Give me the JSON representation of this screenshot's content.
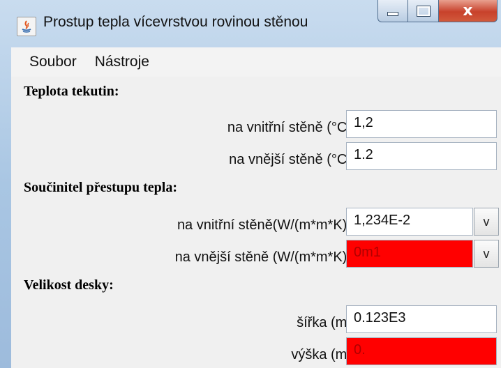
{
  "window": {
    "title": "Prostup tepla vícevrstvou rovinou stěnou",
    "close_glyph": "x"
  },
  "menu": {
    "items": [
      "Soubor",
      "Nástroje"
    ]
  },
  "sections": {
    "fluid_temp": {
      "title": "Teplota tekutin:",
      "inner_label": "na vnitřní stěně (°C)",
      "inner_value": "1,2",
      "outer_label": "na vnější stěně (°C)",
      "outer_value": "1.2"
    },
    "heat_transfer": {
      "title": "Součinitel přestupu tepla:",
      "inner_label": "na vnitřní stěně(W/(m*m*K))",
      "inner_value": "1,234E-2",
      "inner_unit": "v",
      "outer_label": "na vnější stěně (W/(m*m*K))",
      "outer_value": "0m1",
      "outer_unit": "v"
    },
    "plate_size": {
      "title": "Velikost desky:",
      "width_label": "šířka (m)",
      "width_value": "0.123E3",
      "height_label": "výška (m)",
      "height_value": "0."
    }
  },
  "colors": {
    "error_field": "#ff0000",
    "error_text": "#b00000"
  }
}
